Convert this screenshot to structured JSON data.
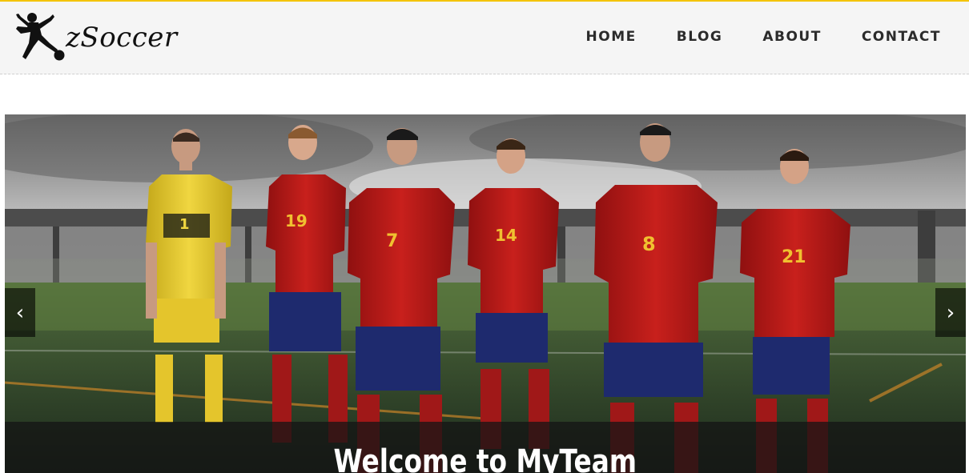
{
  "header": {
    "logo_text": "zSoccer",
    "nav": [
      {
        "label": "HOME"
      },
      {
        "label": "BLOG"
      },
      {
        "label": "ABOUT"
      },
      {
        "label": "CONTACT"
      }
    ],
    "accent_color": "#f4c400"
  },
  "slider": {
    "caption": "Welcome to MyTeam",
    "prev_icon": "‹",
    "next_icon": "›",
    "players": [
      {
        "number": "1",
        "kit": "goalkeeper-yellow"
      },
      {
        "number": "19",
        "kit": "red"
      },
      {
        "number": "7",
        "kit": "red"
      },
      {
        "number": "14",
        "kit": "red"
      },
      {
        "number": "8",
        "kit": "red"
      },
      {
        "number": "21",
        "kit": "red"
      }
    ]
  }
}
